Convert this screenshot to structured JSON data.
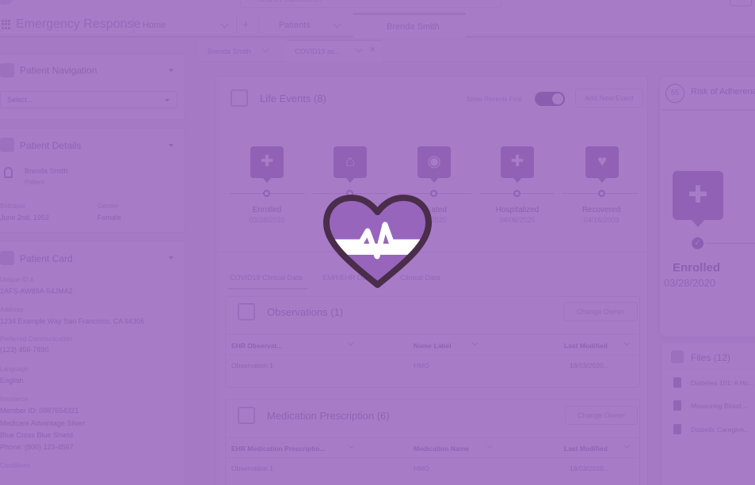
{
  "global_search": {
    "placeholder": "Search Salesforce"
  },
  "nav": {
    "app_name": "Emergency Response",
    "items": [
      {
        "label": "Home"
      },
      {
        "label": "Patients"
      }
    ],
    "active_tab": "Brenda Smith"
  },
  "subtabs": {
    "items": [
      {
        "label": "Brenda Smith"
      },
      {
        "label": "COVID19 as..."
      }
    ]
  },
  "patient_navigation": {
    "title": "Patient Navigation",
    "select_value": "Select..."
  },
  "patient_details": {
    "title": "Patient Details",
    "name": "Brenda Smith",
    "role": "Patient",
    "birthdate_label": "Birthdate",
    "birthdate": "June 2nd, 1952",
    "gender_label": "Gender",
    "gender": "Female"
  },
  "patient_card": {
    "title": "Patient Card",
    "fields": [
      {
        "label": "Unique ID #",
        "value": "2AFS-AW89A-54JMA2"
      },
      {
        "label": "Address",
        "value": "1234 Example Way San Francisco, CA 94305"
      },
      {
        "label": "Preferred Communication",
        "value": "(123) 456-7890"
      },
      {
        "label": "Language",
        "value": "English"
      },
      {
        "label": "Insurance",
        "value": "Member ID: 0987654321"
      }
    ],
    "insurance_extra": [
      "Medicare Advantage Silver",
      "Blue Cross Blue Shield",
      "Phone: (800) 123-4567"
    ],
    "conditions_label": "Conditions"
  },
  "life_events": {
    "title": "Life Events (8)",
    "show_recents_label": "Show Recents First",
    "add_button": "Add New Event",
    "events": [
      {
        "name": "Enrolled",
        "date": "03/28/2020",
        "icon": "shield-plus-icon",
        "glyph": "✚"
      },
      {
        "name": "",
        "date": "",
        "icon": "house-icon",
        "glyph": "⌂"
      },
      {
        "name": "...ated",
        "date": "...2020",
        "icon": "person-icon",
        "glyph": "◉"
      },
      {
        "name": "Hospitalized",
        "date": "04/06/2025",
        "icon": "hospital-icon",
        "glyph": "✚"
      },
      {
        "name": "Recovered",
        "date": "04/16/2009",
        "icon": "heart-pulse-icon",
        "glyph": "♥"
      }
    ]
  },
  "data_tabs": {
    "items": [
      {
        "label": "COVID19 Clinical Data"
      },
      {
        "label": "EMR/EHR Data"
      },
      {
        "label": "Clinical Data"
      }
    ]
  },
  "observations": {
    "title": "Observations (1)",
    "change_owner": "Change Owner",
    "columns": [
      "EHR Observat...",
      "Name Label",
      "Last Modified"
    ],
    "rows": [
      [
        "Observation 1",
        "HMO",
        "18/03/2020..."
      ]
    ]
  },
  "medications": {
    "title": "Medication Prescription (6)",
    "change_owner": "Change Owner",
    "columns": [
      "EHR Medication Prescriptio...",
      "Medication Name",
      "Last Modified"
    ],
    "rows": [
      [
        "Observation 1",
        "HMO",
        "18/03/2020..."
      ]
    ]
  },
  "adherence": {
    "score": "55",
    "title": "Risk of Adherence",
    "event_name": "Enrolled",
    "event_date": "03/28/2020"
  },
  "files": {
    "title": "Files (12)",
    "items": [
      {
        "name": "Diabetes 101: A Ho..."
      },
      {
        "name": "Measuring Blood..."
      },
      {
        "name": "Diabetic Caregive..."
      }
    ]
  },
  "colors": {
    "overlay": "#9865bd",
    "heart_fill": "#9865bd",
    "heart_outline": "#4a2d4a",
    "accent": "#5e4a86"
  }
}
